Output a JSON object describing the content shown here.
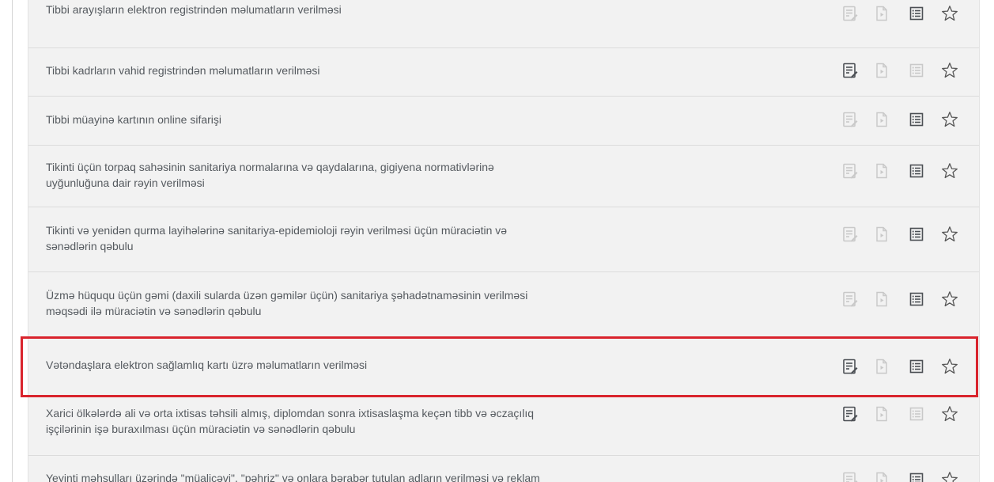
{
  "services": [
    {
      "lines": [
        "Tibbi arayışların elektron registrindən məlumatların verilməsi"
      ],
      "icons": {
        "form": false,
        "video": false,
        "list": true,
        "star": true
      }
    },
    {
      "lines": [
        "Tibbi kadrların vahid registrindən məlumatların verilməsi"
      ],
      "icons": {
        "form": true,
        "video": false,
        "list": false,
        "star": true
      }
    },
    {
      "lines": [
        "Tibbi müayinə kartının online sifarişi"
      ],
      "icons": {
        "form": false,
        "video": false,
        "list": true,
        "star": true
      }
    },
    {
      "lines": [
        "Tikinti üçün torpaq sahəsinin sanitariya normalarına və qaydalarına, gigiyena normativlərinə",
        "uyğunluğuna dair rəyin verilməsi"
      ],
      "icons": {
        "form": false,
        "video": false,
        "list": true,
        "star": true
      }
    },
    {
      "lines": [
        "Tikinti və yenidən qurma layihələrinə sanitariya-epidemioloji rəyin verilməsi üçün müraciətin və",
        "sənədlərin qəbulu"
      ],
      "icons": {
        "form": false,
        "video": false,
        "list": true,
        "star": true
      }
    },
    {
      "lines": [
        "Üzmə hüququ üçün gəmi (daxili sularda üzən gəmilər üçün) sanitariya şəhadətnaməsinin verilməsi",
        "məqsədi ilə müraciətin və sənədlərin qəbulu"
      ],
      "icons": {
        "form": false,
        "video": false,
        "list": true,
        "star": true
      }
    },
    {
      "lines": [
        "Vətəndaşlara elektron sağlamlıq kartı üzrə məlumatların verilməsi"
      ],
      "icons": {
        "form": true,
        "video": false,
        "list": true,
        "star": true
      },
      "highlighted": true
    },
    {
      "lines": [
        "Xarici ölkələrdə ali və orta ixtisas təhsili almış, diplomdan sonra ixtisaslaşma keçən tibb və əczaçılıq",
        "işçilərinin işə buraxılması üçün müraciətin və sənədlərin qəbulu"
      ],
      "icons": {
        "form": true,
        "video": false,
        "list": false,
        "star": true
      }
    },
    {
      "lines": [
        "Yeyinti məhsulları üzərində \"müalicəvi\", \"pəhriz\" və onlara bərabər tutulan adların verilməsi və reklam"
      ],
      "icons": {
        "form": false,
        "video": false,
        "list": true,
        "star": true
      }
    }
  ],
  "colors": {
    "icon_active": "#4b4f54",
    "icon_inactive": "#c9c9c9",
    "star": "#555555",
    "highlight": "#d9242d",
    "panel": "#f2f2f2"
  },
  "icon_names": [
    "form-icon",
    "video-doc-icon",
    "list-icon",
    "star-icon"
  ]
}
